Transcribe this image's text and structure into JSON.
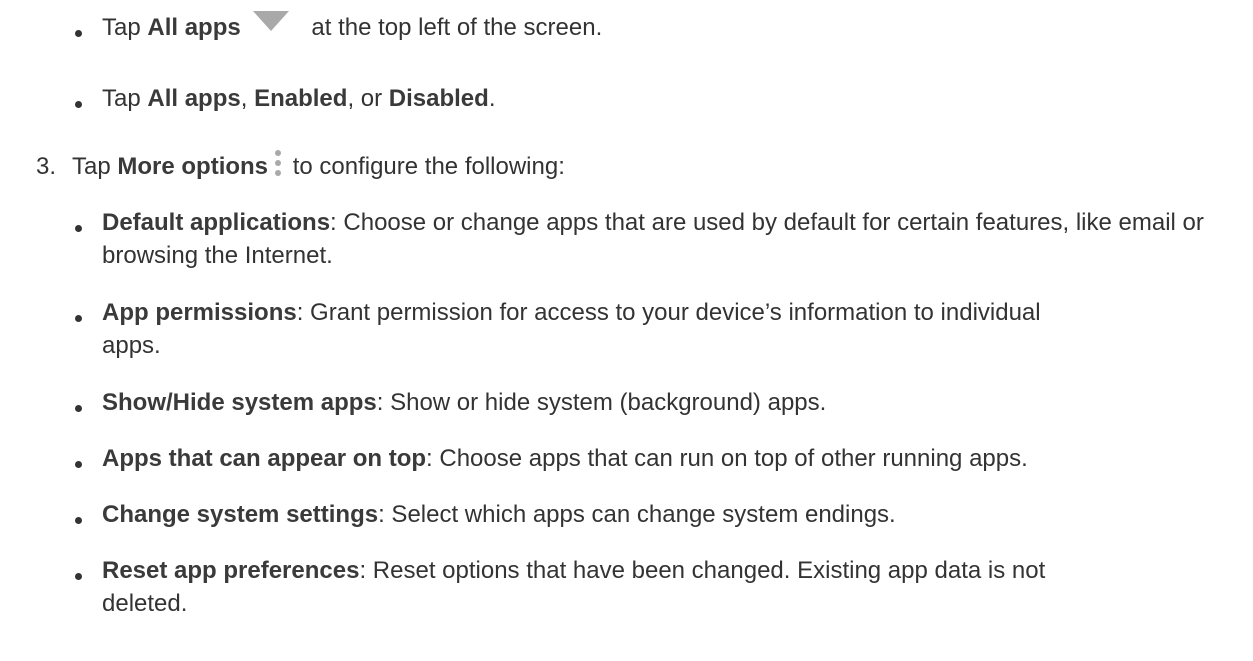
{
  "step2_bullets": [
    {
      "parts_before": "Tap ",
      "bold1": "All apps",
      "after_icon": " at the top left of the screen."
    },
    {
      "text_pre": "Tap ",
      "b1": "All apps",
      "sep1": ", ",
      "b2": "Enabled",
      "sep2": ", or ",
      "b3": "Disabled",
      "end": "."
    }
  ],
  "step3": {
    "number": "3.",
    "pre": "Tap ",
    "bold": "More options",
    "post": " to configure the following:"
  },
  "items": [
    {
      "term": "Default applications",
      "desc": ": Choose or change apps that are used by default for certain features, like email or browsing the Internet."
    },
    {
      "term": "App permissions",
      "desc": ": Grant permission for access to your device’s information to individual apps."
    },
    {
      "term": "Show/Hide system apps",
      "desc": ": Show or hide system (background) apps."
    },
    {
      "term": "Apps that can appear on top",
      "desc": ": Choose apps that can run on top of other running apps."
    },
    {
      "term": "Change system settings",
      "desc": ": Select which apps can change system endings."
    },
    {
      "term": "Reset app preferences",
      "desc": ": Reset options that have been changed. Existing app data is not deleted."
    }
  ],
  "icons": {
    "dropdown": "dropdown-triangle-icon",
    "more": "more-options-icon",
    "icon_color": "#a9a9a9"
  }
}
